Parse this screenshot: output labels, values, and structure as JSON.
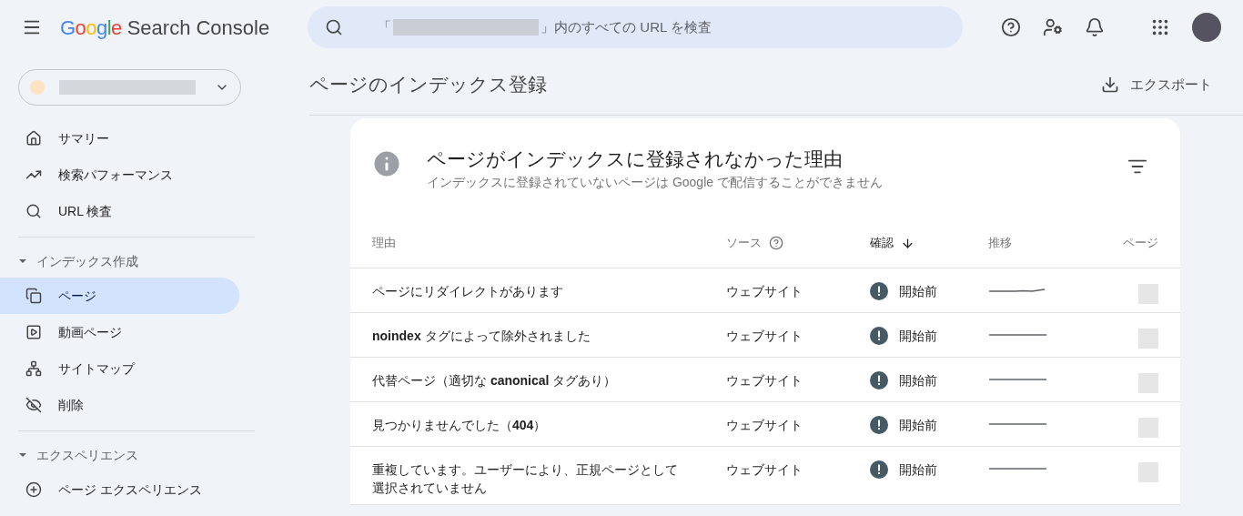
{
  "header": {
    "logo_brand": "Google",
    "logo_product": "Search Console",
    "search": {
      "placeholder_before": "「",
      "placeholder_after": "」内のすべての URL を検査"
    }
  },
  "sidebar": {
    "sections": [
      {
        "items": [
          {
            "label": "サマリー",
            "selected": false
          },
          {
            "label": "検索パフォーマンス",
            "selected": false
          },
          {
            "label": "URL 検査",
            "selected": false
          }
        ]
      },
      {
        "title": "インデックス作成",
        "expanded": true,
        "items": [
          {
            "label": "ページ",
            "selected": true
          },
          {
            "label": "動画ページ",
            "selected": false
          },
          {
            "label": "サイトマップ",
            "selected": false
          },
          {
            "label": "削除",
            "selected": false
          }
        ]
      },
      {
        "title": "エクスペリエンス",
        "expanded": true,
        "items": [
          {
            "label": "ページ エクスペリエンス",
            "selected": false
          }
        ]
      }
    ]
  },
  "page": {
    "title": "ページのインデックス登録",
    "export": "エクスポート"
  },
  "card": {
    "title": "ページがインデックスに登録されなかった理由",
    "subtitle": "インデックスに登録されていないページは Google で配信することができません",
    "columns": [
      {
        "label": "理由",
        "sorted": false
      },
      {
        "label": "ソース",
        "sorted": false
      },
      {
        "label": "確認",
        "sorted": true
      },
      {
        "label": "推移",
        "sorted": false
      },
      {
        "label": "ページ",
        "sorted": false
      }
    ],
    "rows": [
      {
        "reason": "ページにリダイレクトがあります",
        "source": "ウェブサイト",
        "validation": "開始前"
      },
      {
        "reason": "**noindex** タグによって除外されました",
        "source": "ウェブサイト",
        "validation": "開始前"
      },
      {
        "reason": "代替ページ（適切な **canonical** タグあり）",
        "source": "ウェブサイト",
        "validation": "開始前"
      },
      {
        "reason": "見つかりませんでした（**404**）",
        "source": "ウェブサイト",
        "validation": "開始前"
      },
      {
        "reason": "重複しています。ユーザーにより、正規ページとして選択されていません",
        "source": "ウェブサイト",
        "validation": "開始前"
      }
    ]
  }
}
